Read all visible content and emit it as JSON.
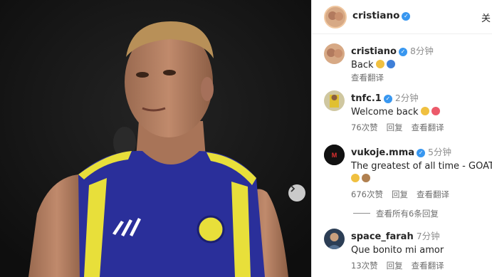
{
  "post": {
    "author": "cristiano",
    "close_label": "关"
  },
  "comments": [
    {
      "user": "cristiano",
      "time": "8分钟",
      "text": "Back",
      "emojis": [
        "#f0c040",
        "#3f7fd8"
      ],
      "actions": [
        "查看翻译"
      ]
    },
    {
      "user": "tnfc.1",
      "time": "2分钟",
      "text": "Welcome back",
      "emojis": [
        "#f0c040",
        "#ec5a6a"
      ],
      "actions": [
        "76次赞",
        "回复",
        "查看翻译"
      ]
    },
    {
      "user": "vukoje.mma",
      "time": "5分钟",
      "text": "The greatest of all time - GOAT",
      "emojis": [
        "#f0c040",
        "#b08050"
      ],
      "actions": [
        "676次赞",
        "回复",
        "查看翻译"
      ]
    },
    {
      "user": "space_farah",
      "time": "7分钟",
      "text": "Que bonito mi amor",
      "emojis": [],
      "actions": [
        "13次赞",
        "回复",
        "查看翻译"
      ]
    }
  ],
  "view_replies_label": "查看所有6条回复",
  "colors": {
    "verified": "#3897f0",
    "jersey_blue": "#2a2f9a",
    "jersey_yellow": "#e8df3a"
  }
}
